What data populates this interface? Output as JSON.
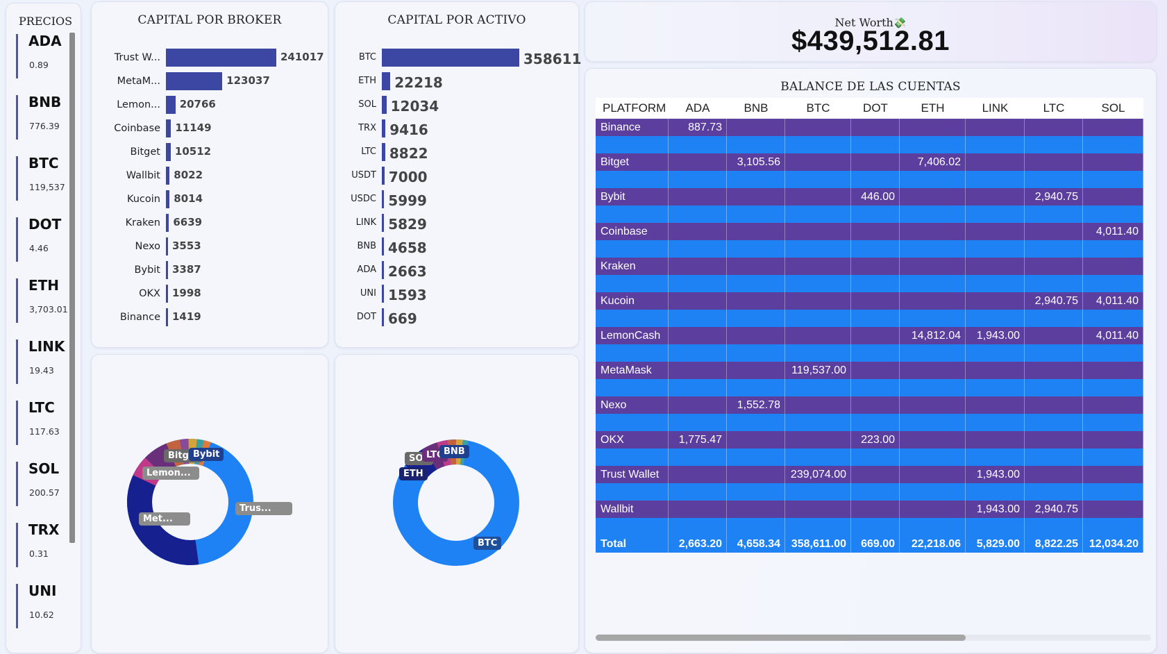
{
  "prices": {
    "title": "PRECIOS",
    "items": [
      {
        "symbol": "ADA",
        "value": "0.89"
      },
      {
        "symbol": "BNB",
        "value": "776.39"
      },
      {
        "symbol": "BTC",
        "value": "119,537"
      },
      {
        "symbol": "DOT",
        "value": "4.46"
      },
      {
        "symbol": "ETH",
        "value": "3,703.01"
      },
      {
        "symbol": "LINK",
        "value": "19.43"
      },
      {
        "symbol": "LTC",
        "value": "117.63"
      },
      {
        "symbol": "SOL",
        "value": "200.57"
      },
      {
        "symbol": "TRX",
        "value": "0.31"
      },
      {
        "symbol": "UNI",
        "value": "10.62"
      }
    ]
  },
  "broker_chart": {
    "title": "CAPITAL POR BROKER",
    "chart_data": {
      "type": "bar",
      "orientation": "horizontal",
      "categories": [
        "Trust W...",
        "MetaM...",
        "Lemon...",
        "Coinbase",
        "Bitget",
        "Wallbit",
        "Kucoin",
        "Kraken",
        "Nexo",
        "Bybit",
        "OKX",
        "Binance"
      ],
      "values": [
        241017,
        123037,
        20766,
        11149,
        10512,
        8022,
        8014,
        6639,
        3553,
        3387,
        1998,
        1419
      ],
      "color": "#3c47a4"
    }
  },
  "asset_chart": {
    "title": "CAPITAL POR ACTIVO",
    "chart_data": {
      "type": "bar",
      "orientation": "horizontal",
      "categories": [
        "BTC",
        "ETH",
        "SOL",
        "TRX",
        "LTC",
        "USDT",
        "USDC",
        "LINK",
        "BNB",
        "ADA",
        "UNI",
        "DOT"
      ],
      "values": [
        358611,
        22218,
        12034,
        9416,
        8822,
        7000,
        5999,
        5829,
        4658,
        2663,
        1593,
        669
      ],
      "color": "#3c47a4"
    }
  },
  "broker_donut": {
    "labels": [
      "Trus...",
      "Met...",
      "Lemon...",
      "Bitget",
      "Bybit"
    ]
  },
  "asset_donut": {
    "labels": [
      "BTC",
      "ETH",
      "SOL",
      "LTC",
      "BNB"
    ]
  },
  "net_worth": {
    "label": "Net Worth",
    "value": "$439,512.81"
  },
  "balance": {
    "title": "BALANCE DE LAS CUENTAS",
    "columns": [
      "PLATFORM",
      "ADA",
      "BNB",
      "BTC",
      "DOT",
      "ETH",
      "LINK",
      "LTC",
      "SOL"
    ],
    "rows": [
      [
        "Binance",
        "887.73",
        "",
        "",
        "",
        "",
        "",
        "",
        ""
      ],
      [
        "Bitget",
        "",
        "3,105.56",
        "",
        "",
        "7,406.02",
        "",
        "",
        ""
      ],
      [
        "Bybit",
        "",
        "",
        "",
        "446.00",
        "",
        "",
        "2,940.75",
        ""
      ],
      [
        "Coinbase",
        "",
        "",
        "",
        "",
        "",
        "",
        "",
        "4,011.40"
      ],
      [
        "Kraken",
        "",
        "",
        "",
        "",
        "",
        "",
        "",
        ""
      ],
      [
        "Kucoin",
        "",
        "",
        "",
        "",
        "",
        "",
        "2,940.75",
        "4,011.40"
      ],
      [
        "LemonCash",
        "",
        "",
        "",
        "",
        "14,812.04",
        "1,943.00",
        "",
        "4,011.40"
      ],
      [
        "MetaMask",
        "",
        "",
        "119,537.00",
        "",
        "",
        "",
        "",
        ""
      ],
      [
        "Nexo",
        "",
        "1,552.78",
        "",
        "",
        "",
        "",
        "",
        ""
      ],
      [
        "OKX",
        "1,775.47",
        "",
        "",
        "223.00",
        "",
        "",
        "",
        ""
      ],
      [
        "Trust Wallet",
        "",
        "",
        "239,074.00",
        "",
        "",
        "1,943.00",
        "",
        ""
      ],
      [
        "Wallbit",
        "",
        "",
        "",
        "",
        "",
        "1,943.00",
        "2,940.75",
        ""
      ]
    ],
    "total": [
      "Total",
      "2,663.20",
      "4,658.34",
      "358,611.00",
      "669.00",
      "22,218.06",
      "5,829.00",
      "8,822.25",
      "12,034.20"
    ]
  },
  "colors": {
    "bar": "#3c47a4",
    "row_purple": "#5b3e9e",
    "row_blue": "#1e82f5"
  }
}
